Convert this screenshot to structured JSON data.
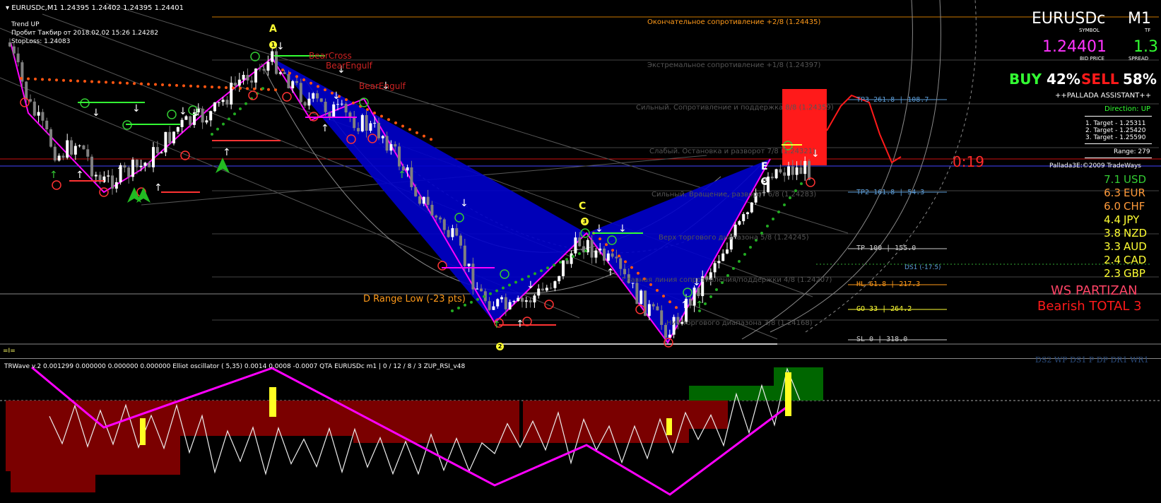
{
  "chart_header": {
    "symbol_line": "EURUSDc,M1  1.24395 1.24402 1.24395 1.24401",
    "trend": "Trend UP",
    "breakout": "Пробит Такбир от 2018.02.02 15:26 1.24282",
    "stoploss": "StopLoss: 1.24083"
  },
  "pattern_labels": {
    "a": "A",
    "c": "C",
    "e": "E",
    "num1": "1",
    "num2": "2",
    "num3": "3",
    "num5": "5"
  },
  "signals": {
    "bearcross": "BearCross",
    "bearengulf1": "BearEngulf",
    "bearengulf2": "BearEngulf",
    "d_range": "D Range Low (-23 pts)"
  },
  "murrey_levels": [
    {
      "text": "Окончательное сопротивление +2/8  (1.24435)",
      "color": "#ff9a1a"
    },
    {
      "text": "Экстремальное сопротивление +1/8  (1.24397)",
      "color": "#555555"
    },
    {
      "text": "Сильный. Сопротивление и поддержка 8/8  (1.24359)",
      "color": "#555555"
    },
    {
      "text": "Слабый. Остановка и разворот 7/8  (1.24321)",
      "color": "#555555"
    },
    {
      "text": "Сильный. Вращение, разворот 6/8  (1.24283)",
      "color": "#555555"
    },
    {
      "text": "Верх торгового диапазона 5/8  (1.24245)",
      "color": "#555555"
    },
    {
      "text": "Главная линия сопротивления/поддержки 4/8  (1.24207)",
      "color": "#555555"
    },
    {
      "text": "Низ торгового диапазона 3/8  (1.24168)",
      "color": "#555555"
    }
  ],
  "targets": [
    {
      "label": "TP3  261.8  | 108.7",
      "color": "#5b9bd5"
    },
    {
      "label": "TP2  161.8  | 54.3",
      "color": "#5b9bd5"
    },
    {
      "label": "TP  100   | 155.0",
      "color": "#cccccc"
    },
    {
      "label": "DS1 (-17.5)",
      "color": "#5b9bd5"
    },
    {
      "label": "HL  61.8  | 217.3",
      "color": "#ff9a1a"
    },
    {
      "label": "GO  33   | 264.2",
      "color": "#ffff33"
    },
    {
      "label": "SL  0    | 318.0",
      "color": "#cccccc"
    }
  ],
  "timer": "0:19",
  "panel": {
    "symbol": "EURUSDc",
    "symbol_caption": "SYMBOL",
    "tf": "M1",
    "tf_caption": "TF",
    "bid": "1.24401",
    "bid_caption": "BID PRICE",
    "spread": "1.3",
    "spread_caption": "SPREAD",
    "buy_label": "BUY",
    "buy_pct": "42%",
    "sell_label": "SELL",
    "sell_pct": "58%",
    "assistant": "++PALLADA ASSISTANT++",
    "direction": "Direction: UP",
    "target1": "1. Target - 1.25311",
    "target2": "2. Target - 1.25420",
    "target3": "3. Target - 1.25590",
    "range": "Range: 279",
    "copyright": "Pallada3E:©2009 TradeWays",
    "currencies": [
      {
        "value": "7.1",
        "name": "USD",
        "color": "#33cc33"
      },
      {
        "value": "6.3",
        "name": "EUR",
        "color": "#ff9a3a"
      },
      {
        "value": "6.0",
        "name": "CHF",
        "color": "#ff9a3a"
      },
      {
        "value": "4.4",
        "name": "JPY",
        "color": "#ffff33"
      },
      {
        "value": "3.8",
        "name": "NZD",
        "color": "#ffff33"
      },
      {
        "value": "3.3",
        "name": "AUD",
        "color": "#ffff33"
      },
      {
        "value": "2.4",
        "name": "CAD",
        "color": "#ffff33"
      },
      {
        "value": "2.3",
        "name": "GBP",
        "color": "#ffff33"
      }
    ],
    "partizan": "WS PARTIZAN",
    "total": "Bearish TOTAL 3",
    "ds_line": "DS2 WP DS1 P DP DR1 WR1"
  },
  "subwindow_caption": "TRWave v.2 0.001299 0.000000 0.000000 0.000000  Elliot oscillator ( 5,35) 0.0014 0.0008 -0.0007  QTA EURUSDc m1 | 0 / 12 / 8 / 3  ZUP_RSI_v48",
  "left_marker": "=I=",
  "colors": {
    "bull": "#ffffff",
    "bear": "#808080",
    "zigzag": "#ff00ff",
    "pattern_fill": "#0000cc",
    "up_dots": "#22aa22",
    "down_dots": "#ff5511",
    "bar_red": "#7a0000",
    "bar_green": "#006600"
  }
}
